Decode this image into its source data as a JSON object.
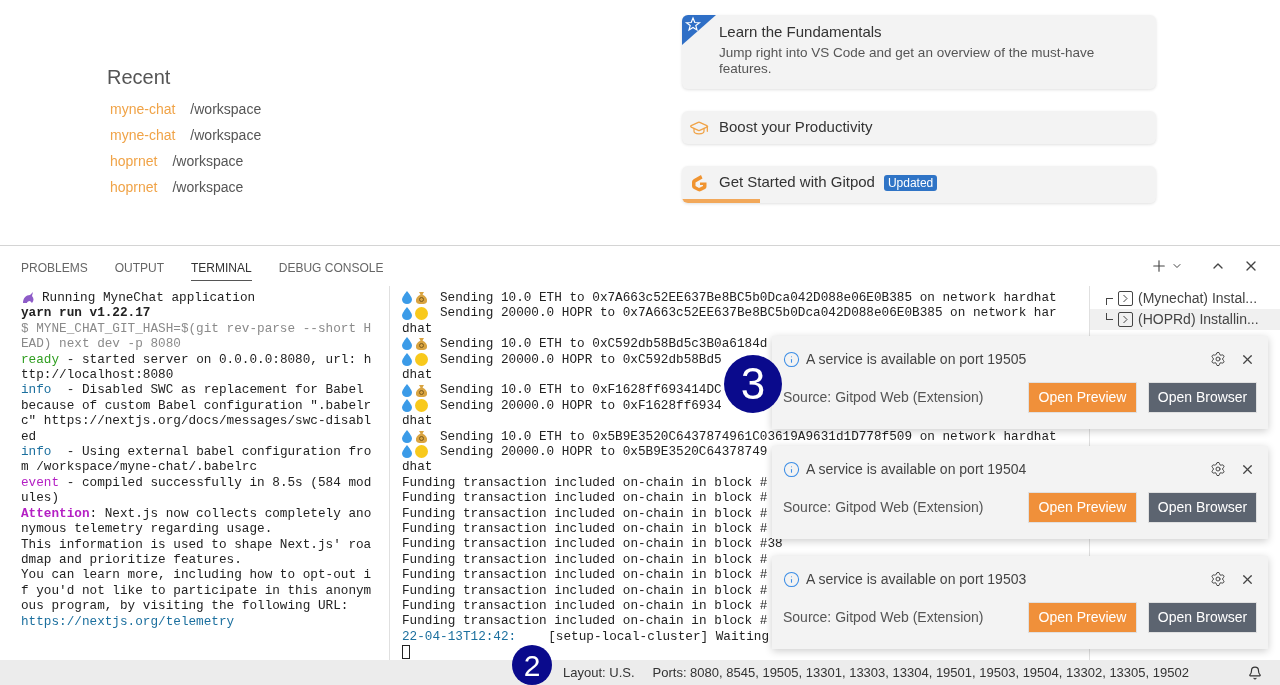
{
  "recent": {
    "title": "Recent",
    "items": [
      {
        "name": "myne-chat",
        "path": "/workspace"
      },
      {
        "name": "myne-chat",
        "path": "/workspace"
      },
      {
        "name": "hoprnet",
        "path": "/workspace"
      },
      {
        "name": "hoprnet",
        "path": "/workspace"
      }
    ]
  },
  "walkthroughs": [
    {
      "kind": "featured",
      "title": "Learn the Fundamentals",
      "description": "Jump right into VS Code and get an overview of the must-have features."
    },
    {
      "kind": "productivity",
      "title": "Boost your Productivity"
    },
    {
      "kind": "gitpod",
      "title": "Get Started with Gitpod",
      "badge": "Updated",
      "level": 0.165
    }
  ],
  "panel": {
    "tabs": [
      {
        "label": "PROBLEMS",
        "selected": false
      },
      {
        "label": "OUTPUT",
        "selected": false
      },
      {
        "label": "TERMINAL",
        "selected": true
      },
      {
        "label": "DEBUG CONSOLE",
        "selected": false
      }
    ],
    "terminal_left": [
      {
        "kind": "title",
        "text": "Running MyneChat application"
      },
      {
        "kind": "bold",
        "text": "yarn run v1.22.17"
      },
      {
        "kind": "dim",
        "text": "$ MYNE_CHAT_GIT_HASH=$(git rev-parse --short H"
      },
      {
        "kind": "dim",
        "text": "EAD) next dev -p 8080"
      },
      {
        "kind": "ready",
        "tag": "ready",
        "text": " - started server on 0.0.0.0:8080, url: h"
      },
      {
        "kind": "plain",
        "text": "ttp://localhost:8080"
      },
      {
        "kind": "info",
        "tag": "info",
        "text": "  - Disabled SWC as replacement for Babel"
      },
      {
        "kind": "plain",
        "text": "because of custom Babel configuration \".babelr"
      },
      {
        "kind": "plain",
        "text": "c\" https://nextjs.org/docs/messages/swc-disabl"
      },
      {
        "kind": "plain",
        "text": "ed"
      },
      {
        "kind": "info",
        "tag": "info",
        "text": "  - Using external babel configuration fro"
      },
      {
        "kind": "plain",
        "text": "m /workspace/myne-chat/.babelrc"
      },
      {
        "kind": "event",
        "tag": "event",
        "text": " - compiled successfully in 8.5s (584 mod"
      },
      {
        "kind": "plain",
        "text": "ules)"
      },
      {
        "kind": "attention",
        "tag": "Attention",
        "text": ": Next.js now collects completely ano"
      },
      {
        "kind": "plain",
        "text": "nymous telemetry regarding usage."
      },
      {
        "kind": "plain",
        "text": "This information is used to shape Next.js' roa"
      },
      {
        "kind": "plain",
        "text": "dmap and prioritize features."
      },
      {
        "kind": "plain",
        "text": "You can learn more, including how to opt-out i"
      },
      {
        "kind": "plain",
        "text": "f you'd not like to participate in this anonym"
      },
      {
        "kind": "plain",
        "text": "ous program, by visiting the following URL:"
      },
      {
        "kind": "link",
        "text": "https://nextjs.org/telemetry"
      }
    ],
    "terminal_main": [
      {
        "kind": "eth",
        "text": "Sending 10.0 ETH to 0x7A663c52EE637Be8BC5b0Dca042D088e06E0B385 on network hardhat"
      },
      {
        "kind": "hopr",
        "text": "Sending 20000.0 HOPR to 0x7A663c52EE637Be8BC5b0Dca042D088e06E0B385 on network har"
      },
      {
        "kind": "plain",
        "text": "dhat"
      },
      {
        "kind": "eth",
        "text": "Sending 10.0 ETH to 0xC592db58Bd5c3B0a6184d"
      },
      {
        "kind": "hopr",
        "text": "Sending 20000.0 HOPR to 0xC592db58Bd5"
      },
      {
        "kind": "plain",
        "text": "dhat"
      },
      {
        "kind": "eth",
        "text": "Sending 10.0 ETH to 0xF1628ff693414DC"
      },
      {
        "kind": "hopr",
        "text": "Sending 20000.0 HOPR to 0xF1628ff6934"
      },
      {
        "kind": "plain",
        "text": "dhat"
      },
      {
        "kind": "eth",
        "text": "Sending 10.0 ETH to 0x5B9E3520C6437874961C03619A9631d1D778f509 on network hardhat"
      },
      {
        "kind": "hopr",
        "text": "Sending 20000.0 HOPR to 0x5B9E3520C64378749"
      },
      {
        "kind": "plain",
        "text": "dhat"
      },
      {
        "kind": "plain",
        "text": "Funding transaction included on-chain in block #"
      },
      {
        "kind": "plain",
        "text": "Funding transaction included on-chain in block #"
      },
      {
        "kind": "plain",
        "text": "Funding transaction included on-chain in block #"
      },
      {
        "kind": "plain",
        "text": "Funding transaction included on-chain in block #"
      },
      {
        "kind": "plain",
        "text": "Funding transaction included on-chain in block #38"
      },
      {
        "kind": "plain",
        "text": "Funding transaction included on-chain in block #"
      },
      {
        "kind": "plain",
        "text": "Funding transaction included on-chain in block #"
      },
      {
        "kind": "plain",
        "text": "Funding transaction included on-chain in block #"
      },
      {
        "kind": "plain",
        "text": "Funding transaction included on-chain in block #"
      },
      {
        "kind": "plain",
        "text": "Funding transaction included on-chain in block #"
      },
      {
        "kind": "log",
        "time": "22-04-13T12:42:",
        "text": "[setup-local-cluster] Waiting"
      },
      {
        "kind": "cursor"
      }
    ],
    "terminals": [
      {
        "label": "(Mynechat) Instal...",
        "selected": false
      },
      {
        "label": "(HOPRd) Installin...",
        "selected": true
      }
    ]
  },
  "notifications": [
    {
      "message": "A service is available on port 19505",
      "source": "Source: Gitpod Web (Extension)",
      "buttons": [
        "Open Preview",
        "Open Browser"
      ]
    },
    {
      "message": "A service is available on port 19504",
      "source": "Source: Gitpod Web (Extension)",
      "buttons": [
        "Open Preview",
        "Open Browser"
      ]
    },
    {
      "message": "A service is available on port 19503",
      "source": "Source: Gitpod Web (Extension)",
      "buttons": [
        "Open Preview",
        "Open Browser"
      ]
    }
  ],
  "status_bar": {
    "layout": "Layout: U.S.",
    "ports": "Ports: 8080, 8545, 19505, 13301, 13303, 13304, 19501, 19503, 19504, 13302, 13305, 19502"
  },
  "callouts": [
    {
      "label": "3",
      "kind": "upper"
    },
    {
      "label": "2",
      "kind": "lower"
    }
  ]
}
